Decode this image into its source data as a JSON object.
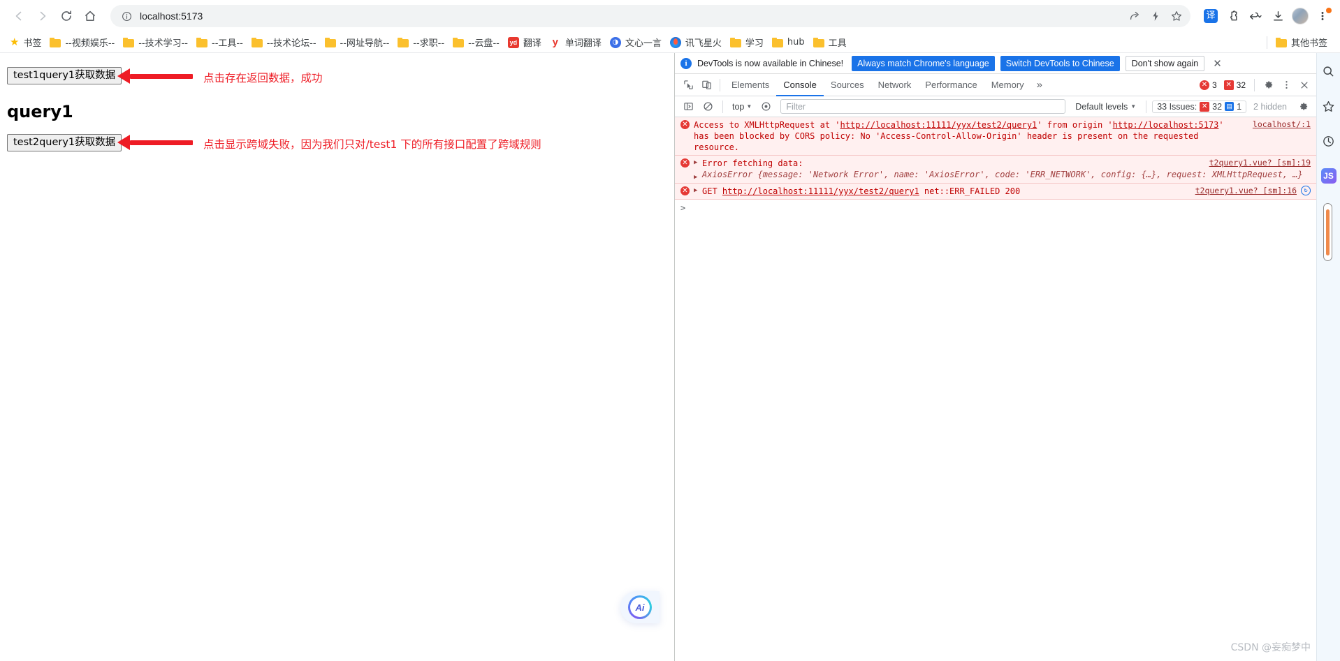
{
  "browser": {
    "url": "localhost:5173",
    "nav": {
      "back": "Back",
      "forward": "Forward",
      "reload": "Reload",
      "home": "Home"
    },
    "omnibox_actions": [
      "share-icon",
      "bolt-icon",
      "bookmark-star-icon"
    ],
    "toolbar_right": [
      "translate-badge",
      "extensions-icon",
      "history-dropdown-icon",
      "downloads-icon",
      "profile-avatar",
      "chrome-menu-icon"
    ],
    "translate_label": "译"
  },
  "bookmarks": {
    "items": [
      {
        "label": "书签",
        "icon": "star-icon"
      },
      {
        "label": "--视频娱乐--",
        "icon": "folder-icon"
      },
      {
        "label": "--技术学习--",
        "icon": "folder-icon"
      },
      {
        "label": "--工具--",
        "icon": "folder-icon"
      },
      {
        "label": "--技术论坛--",
        "icon": "folder-icon"
      },
      {
        "label": "--网址导航--",
        "icon": "folder-icon"
      },
      {
        "label": "--求职--",
        "icon": "folder-icon"
      },
      {
        "label": "--云盘--",
        "icon": "folder-icon"
      },
      {
        "label": "翻译",
        "icon": "yd-favicon"
      },
      {
        "label": "单词翻译",
        "icon": "y-favicon"
      },
      {
        "label": "文心一言",
        "icon": "wenxin-favicon"
      },
      {
        "label": "讯飞星火",
        "icon": "xinghuo-favicon"
      },
      {
        "label": "学习",
        "icon": "folder-icon"
      },
      {
        "label": "hub",
        "icon": "folder-icon"
      },
      {
        "label": "工具",
        "icon": "folder-icon"
      }
    ],
    "other": {
      "label": "其他书签",
      "icon": "folder-icon"
    }
  },
  "page": {
    "button1": "test1query1获取数据",
    "result_text": "query1",
    "button2": "test2query1获取数据",
    "annotation1": "点击存在返回数据，成功",
    "annotation2": "点击显示跨域失败，因为我们只对/test1 下的所有接口配置了跨域规则",
    "ai_fab_label": "Ai"
  },
  "devtools": {
    "infobar": {
      "message": "DevTools is now available in Chinese!",
      "always_match": "Always match Chrome's language",
      "switch": "Switch DevTools to Chinese",
      "dont_show": "Don't show again",
      "close": "✕"
    },
    "tabs": [
      {
        "label": "Elements",
        "active": false
      },
      {
        "label": "Console",
        "active": true
      },
      {
        "label": "Sources",
        "active": false
      },
      {
        "label": "Network",
        "active": false
      },
      {
        "label": "Performance",
        "active": false
      },
      {
        "label": "Memory",
        "active": false
      }
    ],
    "more_tabs": "»",
    "counters": {
      "errors": "3",
      "warnings": "32"
    },
    "toolbar": {
      "context": "top",
      "filter_placeholder": "Filter",
      "levels": "Default levels",
      "issues_label": "33 Issues:",
      "issues_errors": "32",
      "issues_info": "1",
      "hidden": "2 hidden"
    },
    "messages": [
      {
        "kind": "error",
        "expandable": false,
        "segments": [
          {
            "t": "Access to XMLHttpRequest at ",
            "u": false
          },
          {
            "t": "'",
            "u": false
          },
          {
            "t": "http://localhost:11111/yyx/test2/query1",
            "u": true
          },
          {
            "t": "' from origin '",
            "u": false
          },
          {
            "t": "http://localhost:5173",
            "u": true
          },
          {
            "t": "' has been blocked by CORS policy: No 'Access-Control-Allow-Origin' header is present on the requested resource.",
            "u": false
          }
        ],
        "link": "localhost/:1"
      },
      {
        "kind": "error",
        "expandable": true,
        "title": "Error fetching data:",
        "detail_prefix": "AxiosError {message: ",
        "detail": "AxiosError {message: 'Network Error', name: 'AxiosError', code: 'ERR_NETWORK', config: {…}, request: XMLHttpRequest, …}",
        "link": "t2query1.vue? [sm]:19"
      },
      {
        "kind": "error",
        "expandable": true,
        "method": "GET",
        "url": "http://localhost:11111/yyx/test2/query1",
        "status": "net::ERR_FAILED 200",
        "link": "t2query1.vue? [sm]:16",
        "has_reload": true
      }
    ],
    "prompt": ">"
  },
  "right_rail": {
    "icons": [
      "search-icon",
      "favorites-star-icon",
      "history-clock-icon",
      "js-tool-icon"
    ],
    "js_label": "JS"
  },
  "watermark": "CSDN @妄痴梦中"
}
